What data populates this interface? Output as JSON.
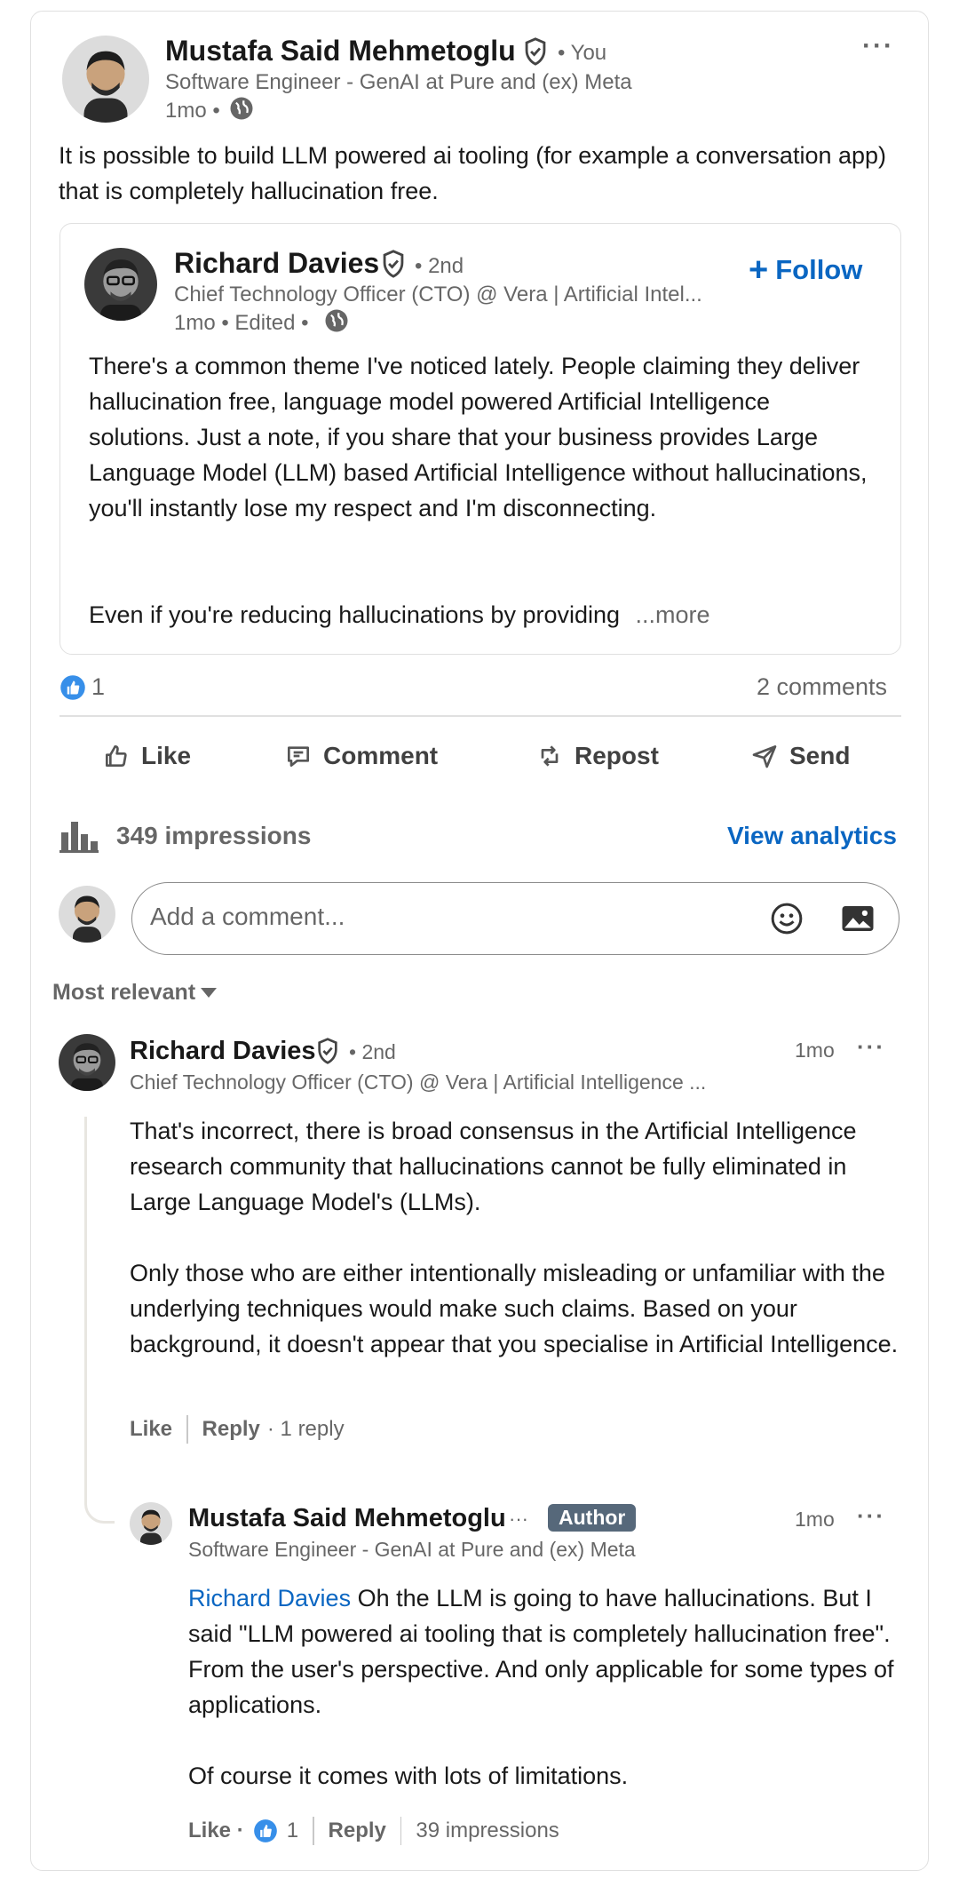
{
  "post": {
    "author_name": "Mustafa Said Mehmetoglu",
    "you_label": "• You",
    "headline": "Software Engineer - GenAI at Pure and (ex) Meta",
    "time": "1mo •",
    "text": "It is possible to build LLM powered ai tooling (for example a conversation app) that is completely hallucination free."
  },
  "repost": {
    "author_name": "Richard Davies",
    "degree": "• 2nd",
    "headline": "Chief Technology Officer (CTO) @ Vera | Artificial Intel...",
    "time": "1mo • Edited •",
    "follow_label": "Follow",
    "paragraph1": "There's a common theme I've noticed lately. People claiming they deliver hallucination free, language model powered Artificial Intelligence solutions. Just a note, if you share that your business provides Large Language Model (LLM) based Artificial Intelligence without hallucinations, you'll instantly lose my respect and I'm disconnecting.",
    "paragraph2": "Even if you're reducing hallucinations by providing",
    "more": "...more"
  },
  "social": {
    "reactions_count": "1",
    "comments_count": "2 comments"
  },
  "actions": {
    "like": "Like",
    "comment": "Comment",
    "repost": "Repost",
    "send": "Send"
  },
  "analytics": {
    "impressions": "349 impressions",
    "view_analytics": "View analytics"
  },
  "comment_input": {
    "placeholder": "Add a comment..."
  },
  "sort": {
    "label": "Most relevant"
  },
  "comment1": {
    "author_name": "Richard Davies",
    "degree": "• 2nd",
    "headline": "Chief Technology Officer (CTO) @ Vera | Artificial Intelligence ...",
    "time": "1mo",
    "paragraph1": "That's incorrect, there is broad consensus in the Artificial Intelligence research community that hallucinations cannot be fully eliminated in Large Language Model's (LLMs).",
    "paragraph2": "Only those who are either intentionally misleading or unfamiliar with the underlying techniques would make such claims. Based on your background, it doesn't appear that you specialise in Artificial Intelligence.",
    "like": "Like",
    "reply": "Reply",
    "reply_count": "· 1 reply"
  },
  "reply1": {
    "author_name": "Mustafa Said Mehmetoglu",
    "ellipsis": "···",
    "badge": "Author",
    "headline": "Software Engineer - GenAI at Pure and (ex) Meta",
    "time": "1mo",
    "mention": "Richard Davies",
    "paragraph1": " Oh the LLM is going to have hallucinations. But I said \"LLM powered ai tooling that is completely hallucination free\". From the user's perspective. And only applicable for some types of applications.",
    "paragraph2": "Of course it comes with lots of limitations.",
    "like": "Like ·",
    "reaction_count": "1",
    "reply": "Reply",
    "impressions": "39 impressions"
  },
  "colors": {
    "link_blue": "#0a66c2",
    "badge_gray": "#56687a",
    "divider": "#e0e0e0"
  }
}
